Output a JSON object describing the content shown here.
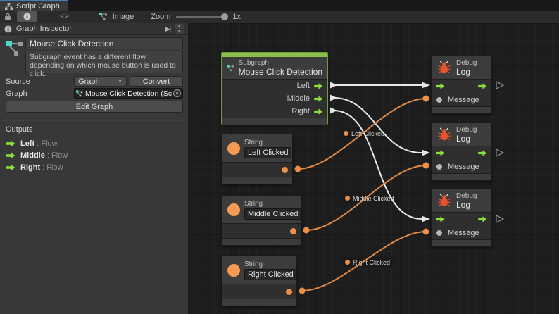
{
  "tab": {
    "label": "Script Graph"
  },
  "toolbar": {
    "image_label": "Image",
    "zoom_label": "Zoom",
    "zoom_value": "1x"
  },
  "inspector": {
    "header": "Graph Inspector",
    "title_value": "Mouse Click Detection",
    "description": "Subgraph event has a different flow depending on which mouse button is used to click.",
    "source_label": "Source",
    "source_value": "Graph",
    "convert_label": "Convert",
    "graph_label": "Graph",
    "graph_value": "Mouse Click Detection (Scri",
    "edit_graph_label": "Edit Graph",
    "outputs_header": "Outputs",
    "outputs": [
      {
        "name": "Left",
        "type": ": Flow"
      },
      {
        "name": "Middle",
        "type": ": Flow"
      },
      {
        "name": "Right",
        "type": ": Flow"
      }
    ]
  },
  "graph": {
    "subgraph_node": {
      "kind": "Subgraph",
      "title": "Mouse Click Detection",
      "ports": [
        {
          "label": "Left"
        },
        {
          "label": "Middle"
        },
        {
          "label": "Right"
        }
      ]
    },
    "string_nodes": [
      {
        "kind": "String",
        "value": "Left Clicked"
      },
      {
        "kind": "String",
        "value": "Middle Clicked"
      },
      {
        "kind": "String",
        "value": "Right Clicked"
      }
    ],
    "debug_nodes": [
      {
        "kind": "Debug",
        "title": "Log",
        "input_label": "Message"
      },
      {
        "kind": "Debug",
        "title": "Log",
        "input_label": "Message"
      },
      {
        "kind": "Debug",
        "title": "Log",
        "input_label": "Message"
      }
    ],
    "wire_labels": [
      {
        "text": "Left Clicked"
      },
      {
        "text": "Middle Clicked"
      },
      {
        "text": "Right Clicked"
      }
    ]
  },
  "icons": {
    "tab": "script-graph-icon",
    "toolbar": [
      "lock-icon",
      "info-icon",
      "code-brackets-icon",
      "graph-image-icon"
    ],
    "inspector": [
      "info-icon",
      "dock-icon",
      "spinner-up-icon",
      "spinner-down-icon",
      "subgraph-icon",
      "dropdown-caret-icon",
      "object-picker-icon",
      "flow-arrow-icon"
    ],
    "nodes": [
      "subgraph-icon",
      "bug-icon",
      "string-circle-icon",
      "flow-arrow-icon",
      "message-port-icon"
    ]
  },
  "colors": {
    "accent_green": "#8ce03a",
    "node_green_cap": "#8cbe4e",
    "accent_orange": "#ef9049",
    "bug_red": "#e8532e",
    "subgraph_teal": "#4ad8c8",
    "wire_white": "#e8e8e8",
    "canvas_bg": "#1d1d1d",
    "panel_bg": "#383838"
  }
}
